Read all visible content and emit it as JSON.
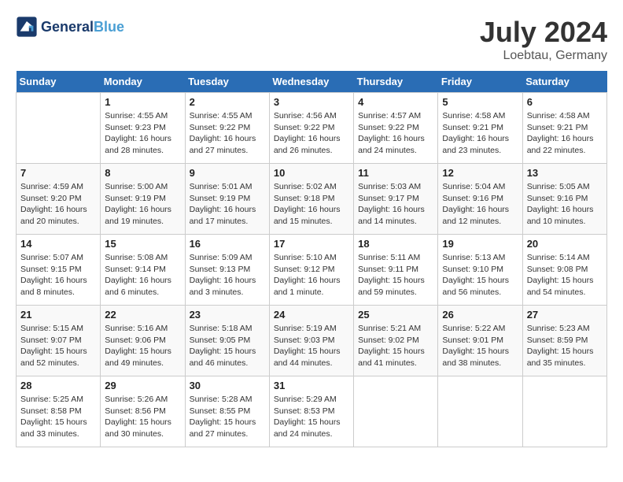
{
  "header": {
    "logo_line1": "General",
    "logo_line2": "Blue",
    "month": "July 2024",
    "location": "Loebtau, Germany"
  },
  "days_of_week": [
    "Sunday",
    "Monday",
    "Tuesday",
    "Wednesday",
    "Thursday",
    "Friday",
    "Saturday"
  ],
  "weeks": [
    [
      {
        "day": "",
        "sunrise": "",
        "sunset": "",
        "daylight": ""
      },
      {
        "day": "1",
        "sunrise": "Sunrise: 4:55 AM",
        "sunset": "Sunset: 9:23 PM",
        "daylight": "Daylight: 16 hours and 28 minutes."
      },
      {
        "day": "2",
        "sunrise": "Sunrise: 4:55 AM",
        "sunset": "Sunset: 9:22 PM",
        "daylight": "Daylight: 16 hours and 27 minutes."
      },
      {
        "day": "3",
        "sunrise": "Sunrise: 4:56 AM",
        "sunset": "Sunset: 9:22 PM",
        "daylight": "Daylight: 16 hours and 26 minutes."
      },
      {
        "day": "4",
        "sunrise": "Sunrise: 4:57 AM",
        "sunset": "Sunset: 9:22 PM",
        "daylight": "Daylight: 16 hours and 24 minutes."
      },
      {
        "day": "5",
        "sunrise": "Sunrise: 4:58 AM",
        "sunset": "Sunset: 9:21 PM",
        "daylight": "Daylight: 16 hours and 23 minutes."
      },
      {
        "day": "6",
        "sunrise": "Sunrise: 4:58 AM",
        "sunset": "Sunset: 9:21 PM",
        "daylight": "Daylight: 16 hours and 22 minutes."
      }
    ],
    [
      {
        "day": "7",
        "sunrise": "Sunrise: 4:59 AM",
        "sunset": "Sunset: 9:20 PM",
        "daylight": "Daylight: 16 hours and 20 minutes."
      },
      {
        "day": "8",
        "sunrise": "Sunrise: 5:00 AM",
        "sunset": "Sunset: 9:19 PM",
        "daylight": "Daylight: 16 hours and 19 minutes."
      },
      {
        "day": "9",
        "sunrise": "Sunrise: 5:01 AM",
        "sunset": "Sunset: 9:19 PM",
        "daylight": "Daylight: 16 hours and 17 minutes."
      },
      {
        "day": "10",
        "sunrise": "Sunrise: 5:02 AM",
        "sunset": "Sunset: 9:18 PM",
        "daylight": "Daylight: 16 hours and 15 minutes."
      },
      {
        "day": "11",
        "sunrise": "Sunrise: 5:03 AM",
        "sunset": "Sunset: 9:17 PM",
        "daylight": "Daylight: 16 hours and 14 minutes."
      },
      {
        "day": "12",
        "sunrise": "Sunrise: 5:04 AM",
        "sunset": "Sunset: 9:16 PM",
        "daylight": "Daylight: 16 hours and 12 minutes."
      },
      {
        "day": "13",
        "sunrise": "Sunrise: 5:05 AM",
        "sunset": "Sunset: 9:16 PM",
        "daylight": "Daylight: 16 hours and 10 minutes."
      }
    ],
    [
      {
        "day": "14",
        "sunrise": "Sunrise: 5:07 AM",
        "sunset": "Sunset: 9:15 PM",
        "daylight": "Daylight: 16 hours and 8 minutes."
      },
      {
        "day": "15",
        "sunrise": "Sunrise: 5:08 AM",
        "sunset": "Sunset: 9:14 PM",
        "daylight": "Daylight: 16 hours and 6 minutes."
      },
      {
        "day": "16",
        "sunrise": "Sunrise: 5:09 AM",
        "sunset": "Sunset: 9:13 PM",
        "daylight": "Daylight: 16 hours and 3 minutes."
      },
      {
        "day": "17",
        "sunrise": "Sunrise: 5:10 AM",
        "sunset": "Sunset: 9:12 PM",
        "daylight": "Daylight: 16 hours and 1 minute."
      },
      {
        "day": "18",
        "sunrise": "Sunrise: 5:11 AM",
        "sunset": "Sunset: 9:11 PM",
        "daylight": "Daylight: 15 hours and 59 minutes."
      },
      {
        "day": "19",
        "sunrise": "Sunrise: 5:13 AM",
        "sunset": "Sunset: 9:10 PM",
        "daylight": "Daylight: 15 hours and 56 minutes."
      },
      {
        "day": "20",
        "sunrise": "Sunrise: 5:14 AM",
        "sunset": "Sunset: 9:08 PM",
        "daylight": "Daylight: 15 hours and 54 minutes."
      }
    ],
    [
      {
        "day": "21",
        "sunrise": "Sunrise: 5:15 AM",
        "sunset": "Sunset: 9:07 PM",
        "daylight": "Daylight: 15 hours and 52 minutes."
      },
      {
        "day": "22",
        "sunrise": "Sunrise: 5:16 AM",
        "sunset": "Sunset: 9:06 PM",
        "daylight": "Daylight: 15 hours and 49 minutes."
      },
      {
        "day": "23",
        "sunrise": "Sunrise: 5:18 AM",
        "sunset": "Sunset: 9:05 PM",
        "daylight": "Daylight: 15 hours and 46 minutes."
      },
      {
        "day": "24",
        "sunrise": "Sunrise: 5:19 AM",
        "sunset": "Sunset: 9:03 PM",
        "daylight": "Daylight: 15 hours and 44 minutes."
      },
      {
        "day": "25",
        "sunrise": "Sunrise: 5:21 AM",
        "sunset": "Sunset: 9:02 PM",
        "daylight": "Daylight: 15 hours and 41 minutes."
      },
      {
        "day": "26",
        "sunrise": "Sunrise: 5:22 AM",
        "sunset": "Sunset: 9:01 PM",
        "daylight": "Daylight: 15 hours and 38 minutes."
      },
      {
        "day": "27",
        "sunrise": "Sunrise: 5:23 AM",
        "sunset": "Sunset: 8:59 PM",
        "daylight": "Daylight: 15 hours and 35 minutes."
      }
    ],
    [
      {
        "day": "28",
        "sunrise": "Sunrise: 5:25 AM",
        "sunset": "Sunset: 8:58 PM",
        "daylight": "Daylight: 15 hours and 33 minutes."
      },
      {
        "day": "29",
        "sunrise": "Sunrise: 5:26 AM",
        "sunset": "Sunset: 8:56 PM",
        "daylight": "Daylight: 15 hours and 30 minutes."
      },
      {
        "day": "30",
        "sunrise": "Sunrise: 5:28 AM",
        "sunset": "Sunset: 8:55 PM",
        "daylight": "Daylight: 15 hours and 27 minutes."
      },
      {
        "day": "31",
        "sunrise": "Sunrise: 5:29 AM",
        "sunset": "Sunset: 8:53 PM",
        "daylight": "Daylight: 15 hours and 24 minutes."
      },
      {
        "day": "",
        "sunrise": "",
        "sunset": "",
        "daylight": ""
      },
      {
        "day": "",
        "sunrise": "",
        "sunset": "",
        "daylight": ""
      },
      {
        "day": "",
        "sunrise": "",
        "sunset": "",
        "daylight": ""
      }
    ]
  ]
}
